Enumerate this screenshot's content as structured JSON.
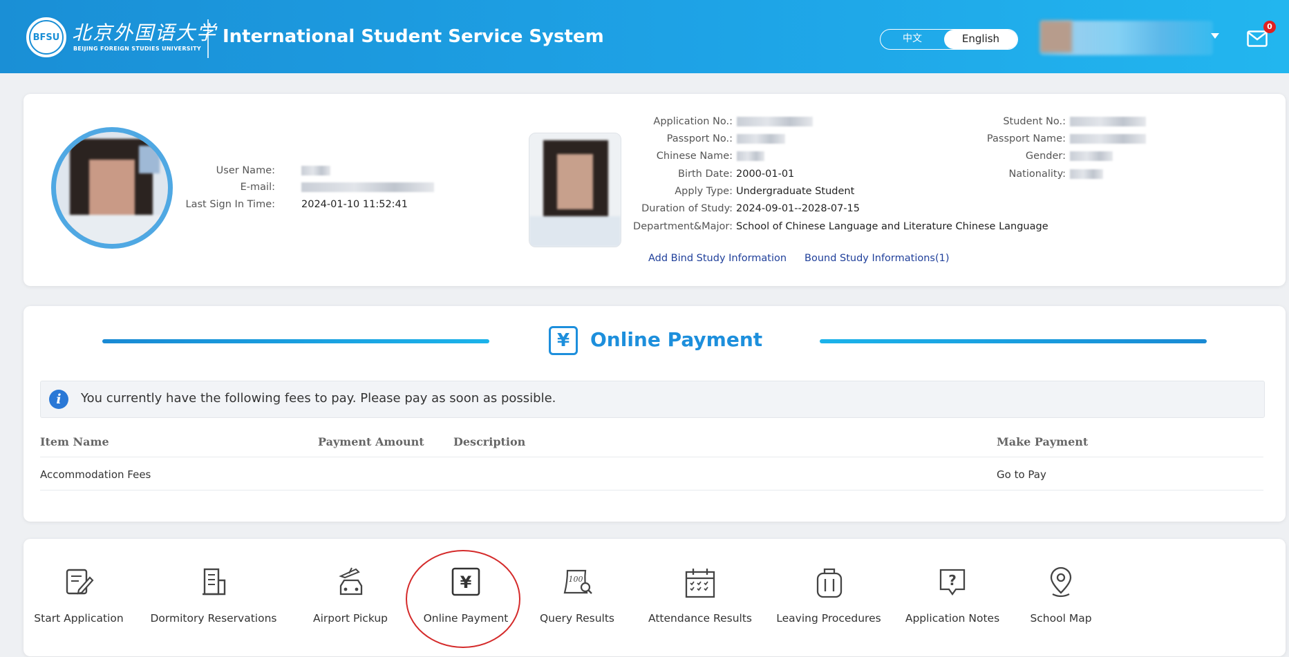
{
  "header": {
    "logo_chinese": "北京外国语大学",
    "logo_english": "BEIJING FOREIGN STUDIES UNIVERSITY",
    "logo_seal_text": "BFSU",
    "system_title": "International Student Service System",
    "lang_chinese": "中文",
    "lang_english": "English",
    "mail_count": "0"
  },
  "profile": {
    "user_name_label": "User Name:",
    "email_label": "E-mail:",
    "last_sign_label": "Last Sign In Time:",
    "last_sign_value": "2024-01-10 11:52:41",
    "application_no_label": "Application No.:",
    "passport_no_label": "Passport No.:",
    "chinese_name_label": "Chinese Name:",
    "birth_date_label": "Birth Date:",
    "birth_date_value": "2000-01-01",
    "apply_type_label": "Apply Type:",
    "apply_type_value": "Undergraduate Student",
    "duration_label": "Duration of Study:",
    "duration_value": "2024-09-01--2028-07-15",
    "dept_label": "Department&Major:",
    "dept_value": "School of Chinese Language and Literature  Chinese Language",
    "student_no_label": "Student No.:",
    "passport_name_label": "Passport Name:",
    "gender_label": "Gender:",
    "nationality_label": "Nationality:",
    "add_bind_link": "Add Bind Study Information",
    "bound_link": "Bound Study Informations(1)"
  },
  "payment": {
    "title": "Online Payment",
    "notice": "You currently have the following fees to pay. Please pay as soon as possible.",
    "columns": [
      "Item Name",
      "Payment Amount",
      "Description",
      "Make Payment"
    ],
    "rows": [
      {
        "item": "Accommodation Fees",
        "amount": "",
        "description": "",
        "action": "Go to Pay"
      }
    ]
  },
  "nav": {
    "items": [
      {
        "label": "Start Application",
        "icon": "edit-icon"
      },
      {
        "label": "Dormitory Reservations",
        "icon": "building-icon"
      },
      {
        "label": "Airport Pickup",
        "icon": "airport-pickup-icon"
      },
      {
        "label": "Online Payment",
        "icon": "yen-icon"
      },
      {
        "label": "Query Results",
        "icon": "score-search-icon"
      },
      {
        "label": "Attendance Results",
        "icon": "calendar-icon"
      },
      {
        "label": "Leaving Procedures",
        "icon": "luggage-icon"
      },
      {
        "label": "Application Notes",
        "icon": "question-icon"
      },
      {
        "label": "School Map",
        "icon": "map-pin-icon"
      }
    ]
  },
  "colors": {
    "header_blue": "#1ea3e6",
    "accent_blue": "#1d8fdc",
    "link_blue": "#1f3f9a",
    "highlight_red": "#d42a2a"
  }
}
